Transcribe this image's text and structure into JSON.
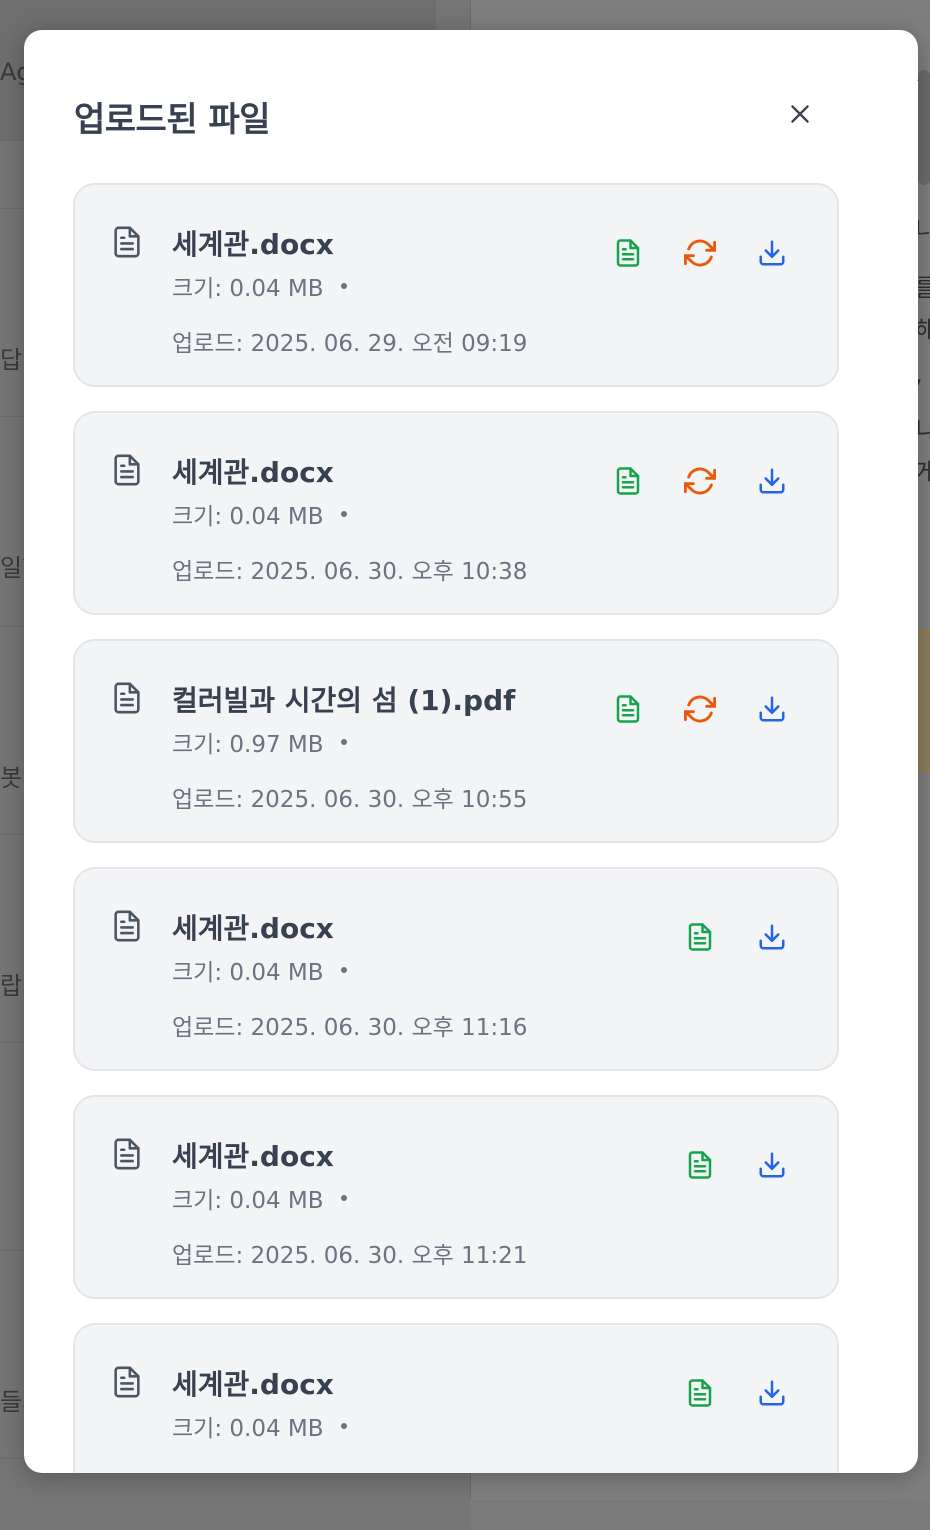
{
  "modal": {
    "title": "업로드된 파일",
    "close_label": "×"
  },
  "colors": {
    "view_icon": "#16a34a",
    "reprocess_icon": "#ea580c",
    "download_icon": "#2563eb"
  },
  "files": [
    {
      "name": "세계관.docx",
      "size": "크기: 0.04 MB",
      "uploaded": "업로드: 2025. 06. 29. 오전 09:19",
      "actions": [
        "view-icon",
        "reprocess-icon",
        "download-icon"
      ]
    },
    {
      "name": "세계관.docx",
      "size": "크기: 0.04 MB",
      "uploaded": "업로드: 2025. 06. 30. 오후 10:38",
      "actions": [
        "view-icon",
        "reprocess-icon",
        "download-icon"
      ]
    },
    {
      "name": "컬러빌과 시간의 섬 (1).pdf",
      "size": "크기: 0.97 MB",
      "uploaded": "업로드: 2025. 06. 30. 오후 10:55",
      "actions": [
        "view-icon",
        "reprocess-icon",
        "download-icon"
      ]
    },
    {
      "name": "세계관.docx",
      "size": "크기: 0.04 MB",
      "uploaded": "업로드: 2025. 06. 30. 오후 11:16",
      "actions": [
        "view-icon",
        "download-icon"
      ]
    },
    {
      "name": "세계관.docx",
      "size": "크기: 0.04 MB",
      "uploaded": "업로드: 2025. 06. 30. 오후 11:21",
      "actions": [
        "view-icon",
        "download-icon"
      ]
    },
    {
      "name": "세계관.docx",
      "size": "크기: 0.04 MB",
      "uploaded": "",
      "actions": [
        "view-icon",
        "download-icon"
      ]
    }
  ],
  "background": {
    "left_fragments": [
      "Ag",
      "답",
      "일함",
      "봇",
      "랍니",
      "들의"
    ],
    "right_fragments": [
      "가",
      "를",
      "나",
      "니",
      "들",
      "해",
      ",",
      "니",
      "게",
      "시",
      "세",
      "시"
    ]
  }
}
